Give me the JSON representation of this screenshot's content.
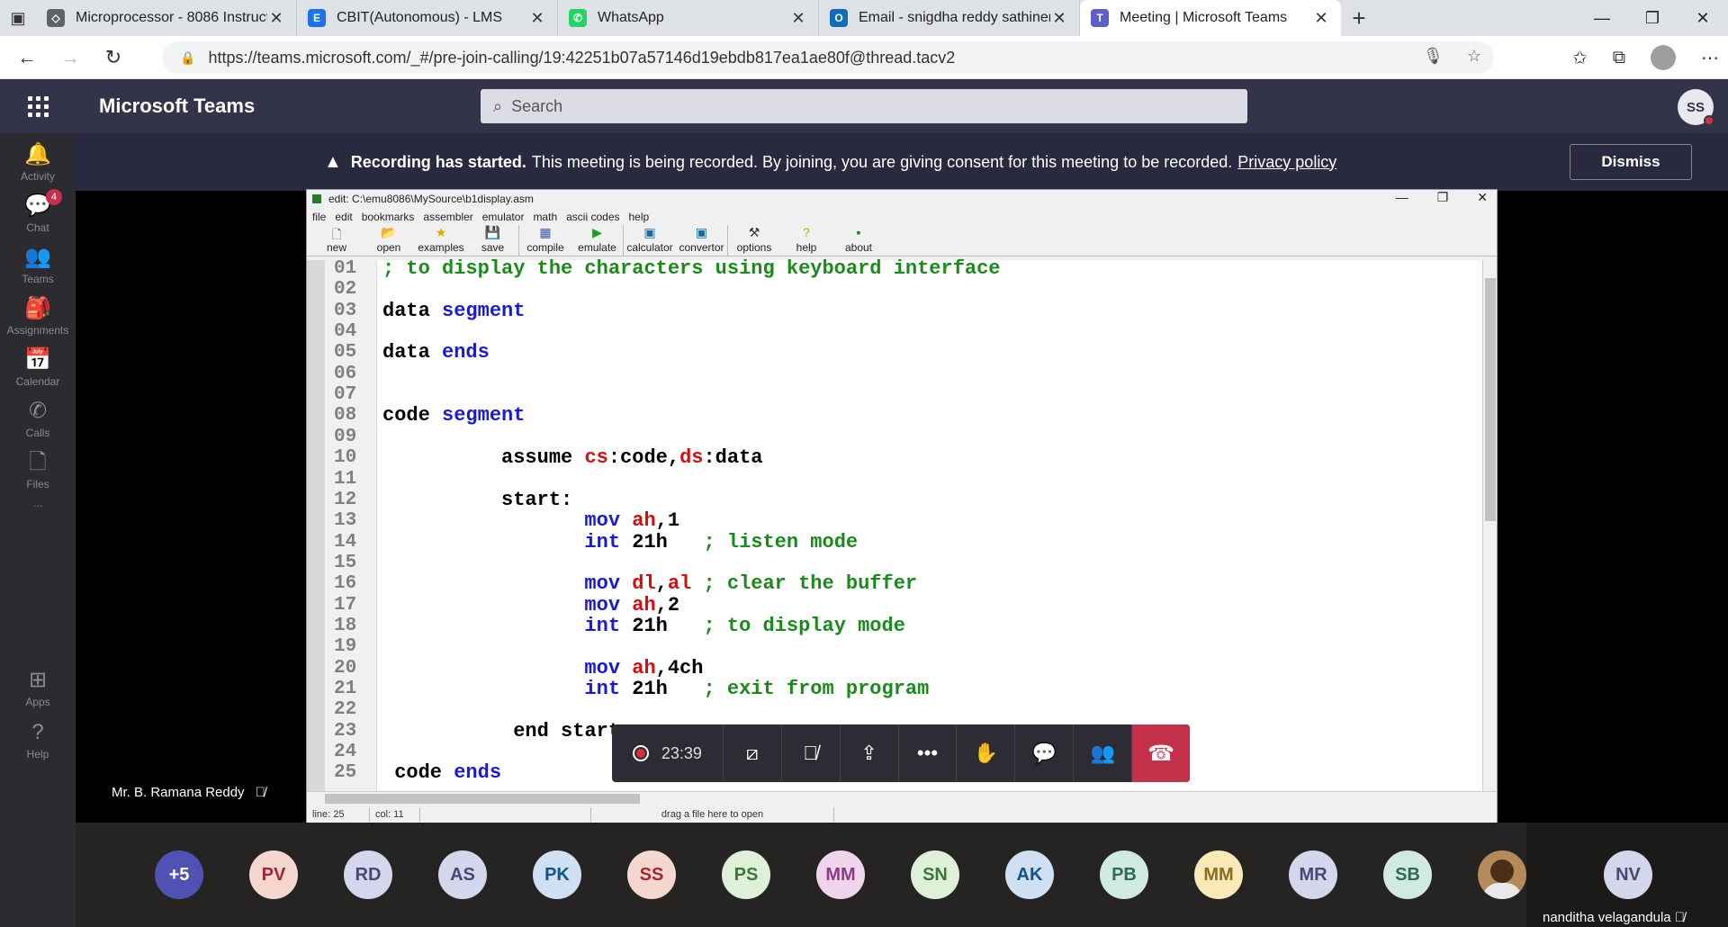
{
  "browser": {
    "tabs": [
      {
        "title": "Microprocessor - 8086 Instructio",
        "fav_color": "#5f6368",
        "fav_text": "◇"
      },
      {
        "title": "CBIT(Autonomous) - LMS",
        "fav_color": "#1a73e8",
        "fav_text": "E"
      },
      {
        "title": "WhatsApp",
        "fav_color": "#25d366",
        "fav_text": "✆"
      },
      {
        "title": "Email - snigdha reddy sathineni",
        "fav_color": "#0f6cbd",
        "fav_text": "O"
      },
      {
        "title": "Meeting | Microsoft Teams",
        "fav_color": "#5b5fc7",
        "fav_text": "T"
      }
    ],
    "url": "https://teams.microsoft.com/_#/pre-join-calling/19:42251b07a57146d19ebdb817ea1ae80f@thread.tacv2"
  },
  "teams": {
    "app_title": "Microsoft Teams",
    "search_placeholder": "Search",
    "user_initials": "SS",
    "rail": [
      {
        "label": "Activity",
        "icon": "bell-icon",
        "glyph": "🔔"
      },
      {
        "label": "Chat",
        "icon": "chat-icon",
        "glyph": "💬",
        "badge": "4"
      },
      {
        "label": "Teams",
        "icon": "teams-icon",
        "glyph": "👥"
      },
      {
        "label": "Assignments",
        "icon": "assignments-icon",
        "glyph": "🎒"
      },
      {
        "label": "Calendar",
        "icon": "calendar-icon",
        "glyph": "📅"
      },
      {
        "label": "Calls",
        "icon": "phone-icon",
        "glyph": "✆"
      },
      {
        "label": "Files",
        "icon": "file-icon",
        "glyph": "🗋"
      },
      {
        "label": "...",
        "icon": "more-icon",
        "glyph": ""
      },
      {
        "label": "Apps",
        "icon": "apps-icon",
        "glyph": "⊞"
      },
      {
        "label": "Help",
        "icon": "help-icon",
        "glyph": "?"
      }
    ],
    "banner": {
      "bold": "Recording has started.",
      "text": "This meeting is being recorded. By joining, you are giving consent for this meeting to be recorded.",
      "link": "Privacy policy",
      "dismiss": "Dismiss"
    },
    "presenter": "Mr. B. Ramana Reddy",
    "controls": {
      "timer": "23:39"
    },
    "participants": [
      {
        "initials": "+5",
        "bg": "#4f52b2",
        "fg": "#ffffff"
      },
      {
        "initials": "PV",
        "bg": "#f6d7d0",
        "fg": "#a4262c"
      },
      {
        "initials": "RD",
        "bg": "#d4d7ec",
        "fg": "#464775"
      },
      {
        "initials": "AS",
        "bg": "#d4d7ec",
        "fg": "#464775"
      },
      {
        "initials": "PK",
        "bg": "#cfe0f3",
        "fg": "#0f548c"
      },
      {
        "initials": "SS",
        "bg": "#f6d7d0",
        "fg": "#a4262c"
      },
      {
        "initials": "PS",
        "bg": "#dff0d8",
        "fg": "#3c763d"
      },
      {
        "initials": "MM",
        "bg": "#f0d4ec",
        "fg": "#8e3a86"
      },
      {
        "initials": "SN",
        "bg": "#dff0d8",
        "fg": "#3c763d"
      },
      {
        "initials": "AK",
        "bg": "#cfe0f3",
        "fg": "#0f548c"
      },
      {
        "initials": "PB",
        "bg": "#d0eae2",
        "fg": "#2d6a58"
      },
      {
        "initials": "MM",
        "bg": "#fbe9b7",
        "fg": "#8a6d1f"
      },
      {
        "initials": "MR",
        "bg": "#d4d7ec",
        "fg": "#464775"
      },
      {
        "initials": "SB",
        "bg": "#d0eae2",
        "fg": "#2d6a58"
      },
      {
        "initials": "",
        "bg": "#b58a5a",
        "fg": "#ffffff"
      }
    ],
    "self": {
      "initials": "NV",
      "name": "nanditha velagandula",
      "bg": "#d4d7ec",
      "fg": "#464775"
    }
  },
  "emu": {
    "title": "edit: C:\\emu8086\\MySource\\b1display.asm",
    "menu": [
      "file",
      "edit",
      "bookmarks",
      "assembler",
      "emulator",
      "math",
      "ascii codes",
      "help"
    ],
    "toolbar": [
      {
        "label": "new",
        "glyph": "🗋",
        "color": "#555555"
      },
      {
        "label": "open",
        "glyph": "📂",
        "color": "#c88a12"
      },
      {
        "label": "examples",
        "glyph": "★",
        "color": "#e0a800"
      },
      {
        "label": "save",
        "glyph": "💾",
        "color": "#333333"
      },
      {
        "label": "compile",
        "glyph": "▦",
        "color": "#3a5aa8"
      },
      {
        "label": "emulate",
        "glyph": "▶",
        "color": "#20a020"
      },
      {
        "label": "calculator",
        "glyph": "▣",
        "color": "#1a6aa8"
      },
      {
        "label": "convertor",
        "glyph": "▣",
        "color": "#1a6aa8"
      },
      {
        "label": "options",
        "glyph": "⚒",
        "color": "#333333"
      },
      {
        "label": "help",
        "glyph": "?",
        "color": "#c8a800"
      },
      {
        "label": "about",
        "glyph": "▪",
        "color": "#208020"
      }
    ],
    "line_numbers": [
      "01",
      "02",
      "03",
      "04",
      "05",
      "06",
      "07",
      "08",
      "09",
      "10",
      "11",
      "12",
      "13",
      "14",
      "15",
      "16",
      "17",
      "18",
      "19",
      "20",
      "21",
      "22",
      "23",
      "24",
      "25"
    ],
    "code_lines": [
      {
        "n": 1,
        "parts": [
          [
            "cm",
            "; to display the characters using keyboard interface"
          ]
        ]
      },
      {
        "n": 3,
        "parts": [
          [
            "",
            "data "
          ],
          [
            "kw",
            "segment"
          ]
        ]
      },
      {
        "n": 5,
        "parts": [
          [
            "",
            "data "
          ],
          [
            "kw",
            "ends"
          ]
        ]
      },
      {
        "n": 8,
        "parts": [
          [
            "",
            "code "
          ],
          [
            "kw",
            "segment"
          ]
        ]
      },
      {
        "n": 10,
        "parts": [
          [
            "",
            "          assume "
          ],
          [
            "reg",
            "cs"
          ],
          [
            "",
            ":code,"
          ],
          [
            "reg",
            "ds"
          ],
          [
            "",
            ":data"
          ]
        ]
      },
      {
        "n": 12,
        "parts": [
          [
            "",
            "          start:"
          ]
        ]
      },
      {
        "n": 13,
        "parts": [
          [
            "kw",
            "                 mov "
          ],
          [
            "reg",
            "ah"
          ],
          [
            "",
            ",1"
          ]
        ]
      },
      {
        "n": 14,
        "parts": [
          [
            "kw",
            "                 int "
          ],
          [
            "",
            "21h  "
          ],
          [
            "cm",
            " ; listen mode"
          ]
        ]
      },
      {
        "n": 16,
        "parts": [
          [
            "kw",
            "                 mov "
          ],
          [
            "reg",
            "dl"
          ],
          [
            "",
            ","
          ],
          [
            "reg",
            "al"
          ],
          [
            "cm",
            " ; clear the buffer"
          ]
        ]
      },
      {
        "n": 17,
        "parts": [
          [
            "kw",
            "                 mov "
          ],
          [
            "reg",
            "ah"
          ],
          [
            "",
            ",2"
          ]
        ]
      },
      {
        "n": 18,
        "parts": [
          [
            "kw",
            "                 int "
          ],
          [
            "",
            "21h   "
          ],
          [
            "cm",
            "; to display mode"
          ]
        ]
      },
      {
        "n": 20,
        "parts": [
          [
            "kw",
            "                 mov "
          ],
          [
            "reg",
            "ah"
          ],
          [
            "",
            ",4ch"
          ]
        ]
      },
      {
        "n": 21,
        "parts": [
          [
            "kw",
            "                 int "
          ],
          [
            "",
            "21h   "
          ],
          [
            "cm",
            "; exit from program"
          ]
        ]
      },
      {
        "n": 23,
        "parts": [
          [
            "",
            "           end "
          ],
          [
            "",
            "start"
          ]
        ]
      },
      {
        "n": 25,
        "parts": [
          [
            "",
            " code "
          ],
          [
            "kw",
            "ends"
          ]
        ]
      }
    ],
    "status": {
      "line": "line: 25",
      "col": "col: 11",
      "hint": "drag a file here to open"
    }
  }
}
